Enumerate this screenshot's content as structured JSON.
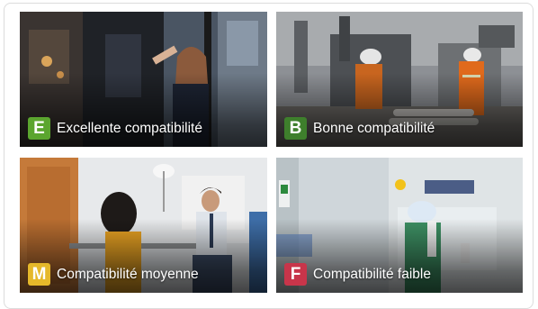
{
  "cards": [
    {
      "letter": "E",
      "caption": "Excellente compatibilité",
      "badge_color": "#5ba52f",
      "icon": "office-worker-photo"
    },
    {
      "letter": "B",
      "caption": "Bonne compatibilité",
      "badge_color": "#3e7f2c",
      "icon": "industrial-workers-photo"
    },
    {
      "letter": "M",
      "caption": "Compatibilité moyenne",
      "badge_color": "#e5b82a",
      "icon": "meeting-photo"
    },
    {
      "letter": "F",
      "caption": "Compatibilité faible",
      "badge_color": "#c8354a",
      "icon": "lab-technician-photo"
    }
  ]
}
